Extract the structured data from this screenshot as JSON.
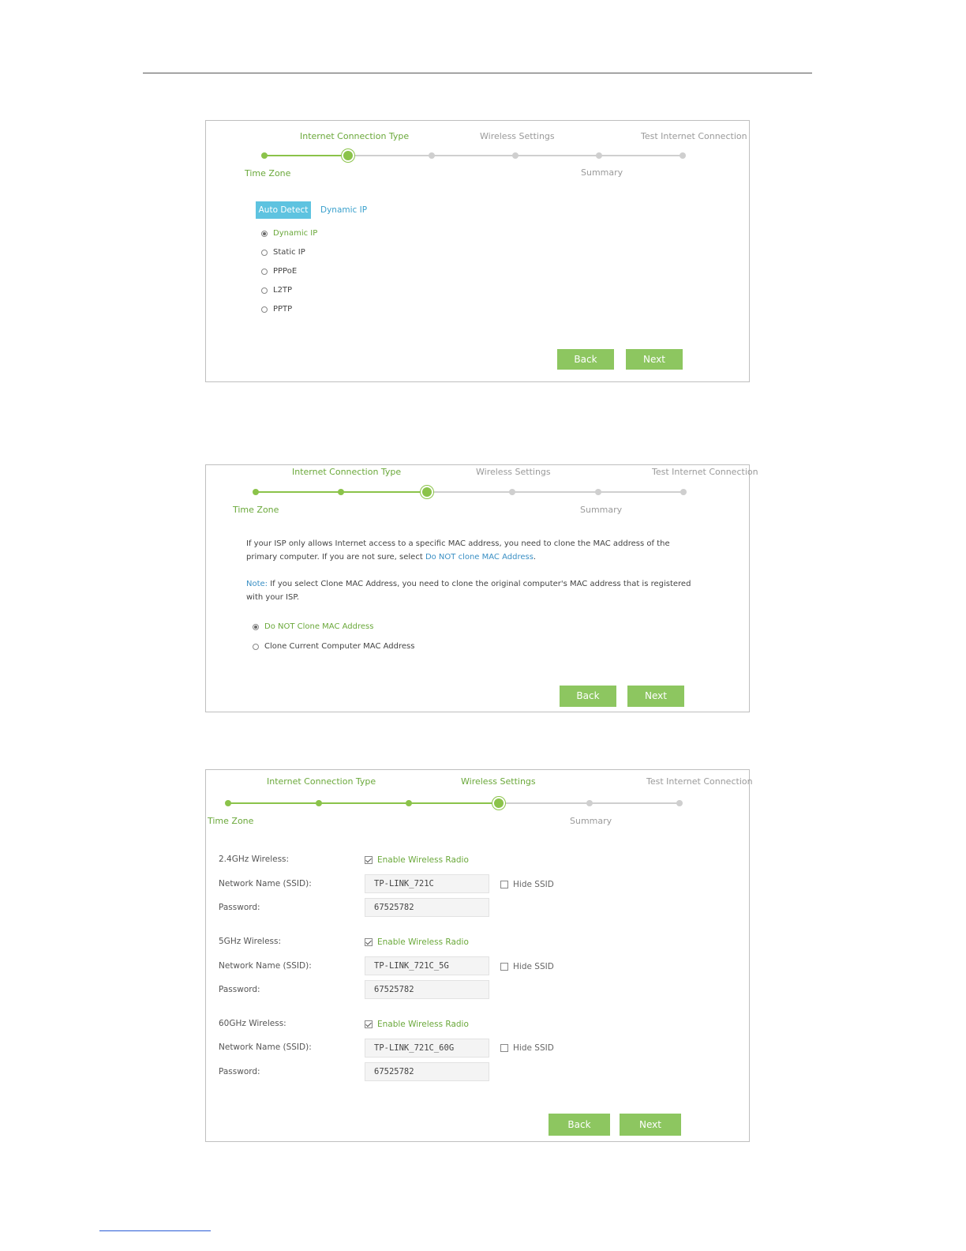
{
  "step_labels": {
    "internet_connection_type": "Internet Connection Type",
    "wireless_settings": "Wireless Settings",
    "test_internet_connection": "Test Internet Connection",
    "time_zone": "Time Zone",
    "summary": "Summary"
  },
  "buttons": {
    "back": "Back",
    "next": "Next"
  },
  "panel1": {
    "tabs": {
      "active": "Auto Detect",
      "link": "Dynamic IP"
    },
    "options": [
      "Dynamic IP",
      "Static IP",
      "PPPoE",
      "L2TP",
      "PPTP"
    ],
    "selected_option": "Dynamic IP"
  },
  "panel2": {
    "para1_a": "If your ISP only allows Internet access to a specific MAC address, you need to clone the MAC address of the",
    "para1_b": "primary computer. If you are not sure, select ",
    "para1_link": "Do NOT clone MAC Address",
    "para1_end": ".",
    "note_label": "Note:",
    "note_a": " If you select Clone MAC Address, you need to clone the original computer's MAC address that is registered",
    "note_b": "with your ISP.",
    "options": [
      "Do NOT Clone MAC Address",
      "Clone Current Computer MAC Address"
    ],
    "selected_option": "Do NOT Clone MAC Address"
  },
  "panel3": {
    "bands": [
      {
        "label": "2.4GHz Wireless:",
        "enable": "Enable Wireless Radio",
        "enabled": true,
        "ssid_label": "Network Name (SSID):",
        "ssid": "TP-LINK_721C",
        "hide": "Hide SSID",
        "hidden": false,
        "pw_label": "Password:",
        "password": "67525782"
      },
      {
        "label": "5GHz Wireless:",
        "enable": "Enable Wireless Radio",
        "enabled": true,
        "ssid_label": "Network Name (SSID):",
        "ssid": "TP-LINK_721C_5G",
        "hide": "Hide SSID",
        "hidden": false,
        "pw_label": "Password:",
        "password": "67525782"
      },
      {
        "label": "60GHz Wireless:",
        "enable": "Enable Wireless Radio",
        "enabled": true,
        "ssid_label": "Network Name (SSID):",
        "ssid": "TP-LINK_721C_60G",
        "hide": "Hide SSID",
        "hidden": false,
        "pw_label": "Password:",
        "password": "67525782"
      }
    ]
  },
  "colors": {
    "accent_green": "#8dc660",
    "tab_blue": "#5ec3e0",
    "link_blue": "#3a8fc4"
  }
}
